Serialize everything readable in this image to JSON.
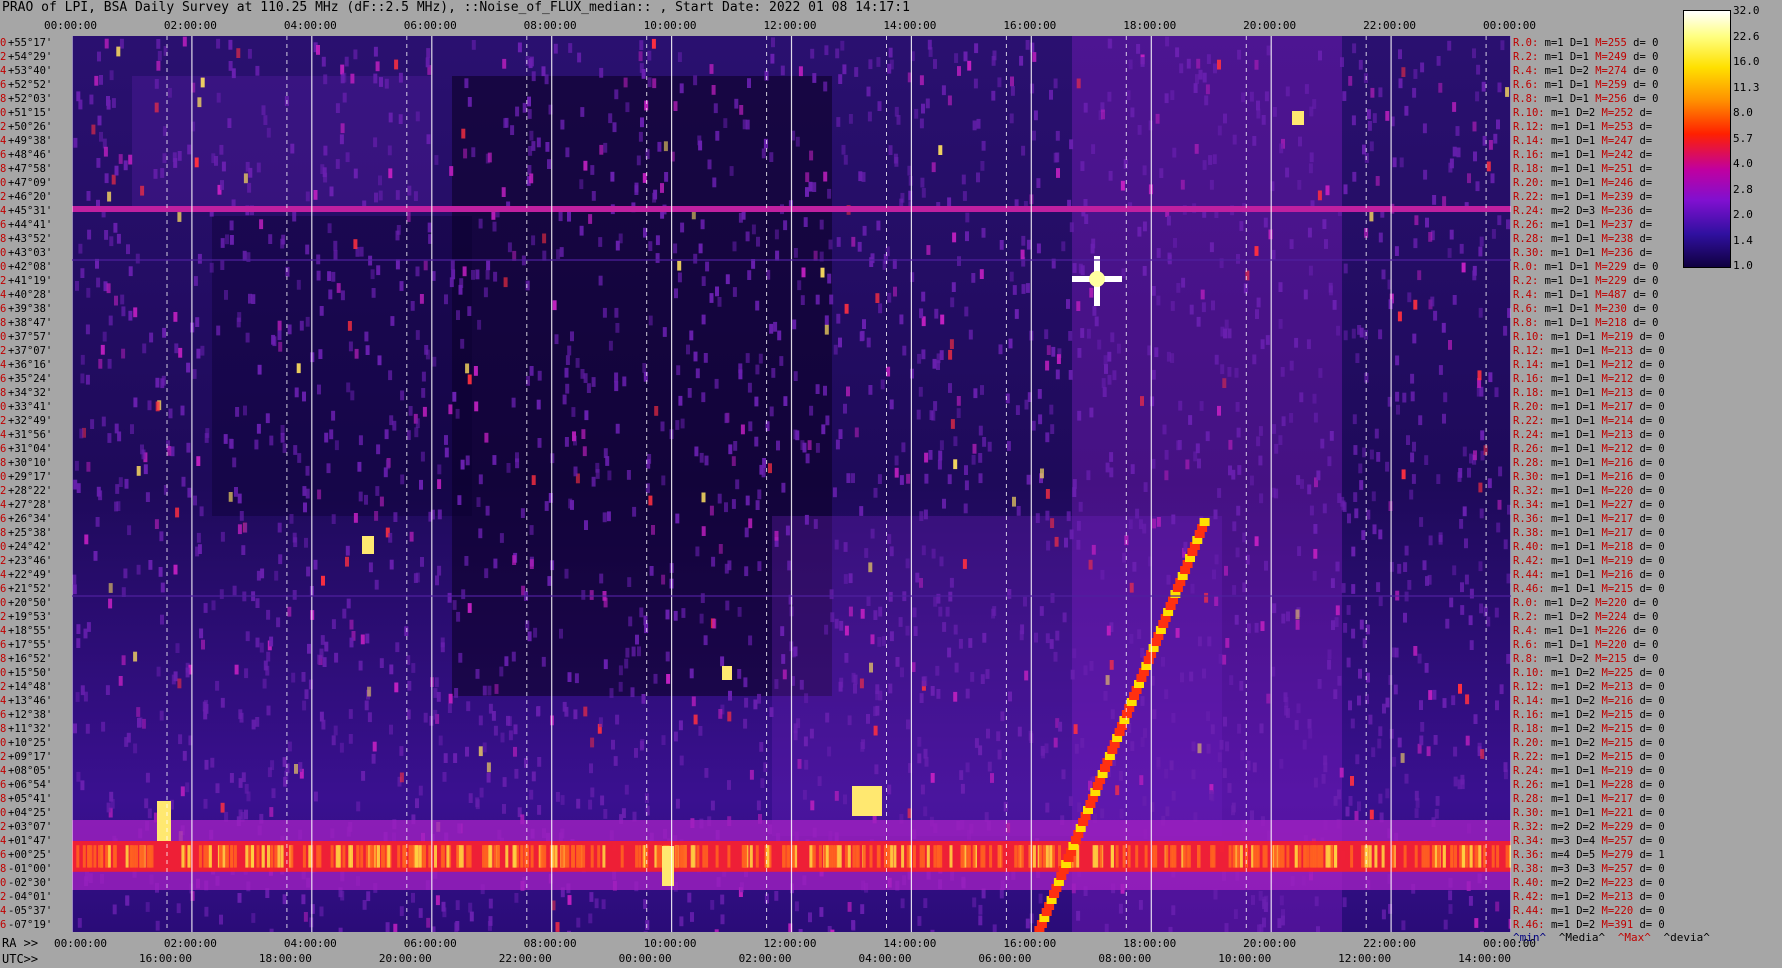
{
  "title": "PRAO of LPI, BSA Daily Survey at 110.25 MHz (dF::2.5 MHz), ::Noise_of_FLUX_median:: , Start Date: 2022 01 08 14:17:1",
  "chart_data": {
    "type": "heatmap",
    "title": "PRAO of LPI, BSA Daily Survey at 110.25 MHz (dF::2.5 MHz), ::Noise_of_FLUX_median:: , Start Date: 2022 01 08 14:17:1",
    "top_axis_ticks": [
      "00:00:00",
      "02:00:00",
      "04:00:00",
      "06:00:00",
      "08:00:00",
      "10:00:00",
      "12:00:00",
      "14:00:00",
      "16:00:00",
      "18:00:00",
      "20:00:00",
      "22:00:00",
      "00:00:00"
    ],
    "ra_axis_label": "RA >>",
    "ra_axis_ticks": [
      "00:00:00",
      "02:00:00",
      "04:00:00",
      "06:00:00",
      "08:00:00",
      "10:00:00",
      "12:00:00",
      "14:00:00",
      "16:00:00",
      "18:00:00",
      "20:00:00",
      "22:00:00",
      "00:00:00"
    ],
    "utc_axis_label": "UTC>>",
    "utc_axis_ticks": [
      "16:00:00",
      "18:00:00",
      "20:00:00",
      "22:00:00",
      "00:00:00",
      "02:00:00",
      "04:00:00",
      "06:00:00",
      "08:00:00",
      "10:00:00",
      "12:00:00",
      "14:00:00"
    ],
    "colorbar_ticks": [
      "32.0",
      "22.6",
      "16.0",
      "11.3",
      "8.0",
      "5.7",
      "4.0",
      "2.8",
      "2.0",
      "1.4",
      "1.0"
    ],
    "declinations": [
      "+55°17'",
      "+54°29'",
      "+53°40'",
      "+52°52'",
      "+52°03'",
      "+51°15'",
      "+50°26'",
      "+49°38'",
      "+48°46'",
      "+47°58'",
      "+47°09'",
      "+46°20'",
      "+45°31'",
      "+44°41'",
      "+43°52'",
      "+43°03'",
      "+42°08'",
      "+41°19'",
      "+40°28'",
      "+39°38'",
      "+38°47'",
      "+37°57'",
      "+37°07'",
      "+36°16'",
      "+35°24'",
      "+34°32'",
      "+33°41'",
      "+32°49'",
      "+31°56'",
      "+31°04'",
      "+30°10'",
      "+29°17'",
      "+28°22'",
      "+27°28'",
      "+26°34'",
      "+25°38'",
      "+24°42'",
      "+23°46'",
      "+22°49'",
      "+21°52'",
      "+20°50'",
      "+19°53'",
      "+18°55'",
      "+17°55'",
      "+16°52'",
      "+15°50'",
      "+14°48'",
      "+13°46'",
      "+12°38'",
      "+11°32'",
      "+10°25'",
      "+09°17'",
      "+08°05'",
      "+06°54'",
      "+05°41'",
      "+04°25'",
      "+03°07'",
      "+01°47'",
      "+00°25'",
      "-01°00'",
      "-02°30'",
      "-04°01'",
      "-05°37'",
      "-07°19'"
    ],
    "row_index": [
      "0",
      "2",
      "4",
      "6",
      "8",
      "10",
      "12",
      "14",
      "16",
      "18",
      "20",
      "22",
      "24",
      "26",
      "28",
      "30",
      "0",
      "2",
      "4",
      "6",
      "8",
      "10",
      "12",
      "14",
      "16",
      "18",
      "20",
      "22",
      "24",
      "26",
      "28",
      "30",
      "32",
      "34",
      "36",
      "38",
      "40",
      "42",
      "44",
      "46",
      "0",
      "2",
      "4",
      "6",
      "8",
      "10",
      "12",
      "14",
      "16",
      "18",
      "20",
      "22",
      "24",
      "26",
      "28",
      "30",
      "32",
      "34",
      "36",
      "38",
      "40",
      "42",
      "44",
      "46"
    ],
    "stats": [
      {
        "r": "R.0:",
        "m": "m=1",
        "D": "D=1",
        "M": "M=255",
        "d": "d= 0"
      },
      {
        "r": "R.2:",
        "m": "m=1",
        "D": "D=1",
        "M": "M=249",
        "d": "d= 0"
      },
      {
        "r": "R.4:",
        "m": "m=1",
        "D": "D=2",
        "M": "M=274",
        "d": "d= 0"
      },
      {
        "r": "R.6:",
        "m": "m=1",
        "D": "D=1",
        "M": "M=259",
        "d": "d= 0"
      },
      {
        "r": "R.8:",
        "m": "m=1",
        "D": "D=1",
        "M": "M=256",
        "d": "d= 0"
      },
      {
        "r": "R.10:",
        "m": "m=1",
        "D": "D=2",
        "M": "M=252",
        "d": "d="
      },
      {
        "r": "R.12:",
        "m": "m=1",
        "D": "D=1",
        "M": "M=253",
        "d": "d="
      },
      {
        "r": "R.14:",
        "m": "m=1",
        "D": "D=1",
        "M": "M=247",
        "d": "d="
      },
      {
        "r": "R.16:",
        "m": "m=1",
        "D": "D=1",
        "M": "M=242",
        "d": "d="
      },
      {
        "r": "R.18:",
        "m": "m=1",
        "D": "D=1",
        "M": "M=251",
        "d": "d="
      },
      {
        "r": "R.20:",
        "m": "m=1",
        "D": "D=1",
        "M": "M=246",
        "d": "d="
      },
      {
        "r": "R.22:",
        "m": "m=1",
        "D": "D=1",
        "M": "M=239",
        "d": "d="
      },
      {
        "r": "R.24:",
        "m": "m=2",
        "D": "D=3",
        "M": "M=236",
        "d": "d="
      },
      {
        "r": "R.26:",
        "m": "m=1",
        "D": "D=1",
        "M": "M=237",
        "d": "d="
      },
      {
        "r": "R.28:",
        "m": "m=1",
        "D": "D=1",
        "M": "M=238",
        "d": "d="
      },
      {
        "r": "R.30:",
        "m": "m=1",
        "D": "D=1",
        "M": "M=236",
        "d": "d="
      },
      {
        "r": "R.0:",
        "m": "m=1",
        "D": "D=1",
        "M": "M=229",
        "d": "d= 0"
      },
      {
        "r": "R.2:",
        "m": "m=1",
        "D": "D=1",
        "M": "M=229",
        "d": "d= 0"
      },
      {
        "r": "R.4:",
        "m": "m=1",
        "D": "D=1",
        "M": "M=487",
        "d": "d= 0"
      },
      {
        "r": "R.6:",
        "m": "m=1",
        "D": "D=1",
        "M": "M=230",
        "d": "d= 0"
      },
      {
        "r": "R.8:",
        "m": "m=1",
        "D": "D=1",
        "M": "M=218",
        "d": "d= 0"
      },
      {
        "r": "R.10:",
        "m": "m=1",
        "D": "D=1",
        "M": "M=219",
        "d": "d= 0"
      },
      {
        "r": "R.12:",
        "m": "m=1",
        "D": "D=1",
        "M": "M=213",
        "d": "d= 0"
      },
      {
        "r": "R.14:",
        "m": "m=1",
        "D": "D=1",
        "M": "M=212",
        "d": "d= 0"
      },
      {
        "r": "R.16:",
        "m": "m=1",
        "D": "D=1",
        "M": "M=212",
        "d": "d= 0"
      },
      {
        "r": "R.18:",
        "m": "m=1",
        "D": "D=1",
        "M": "M=213",
        "d": "d= 0"
      },
      {
        "r": "R.20:",
        "m": "m=1",
        "D": "D=1",
        "M": "M=217",
        "d": "d= 0"
      },
      {
        "r": "R.22:",
        "m": "m=1",
        "D": "D=1",
        "M": "M=214",
        "d": "d= 0"
      },
      {
        "r": "R.24:",
        "m": "m=1",
        "D": "D=1",
        "M": "M=213",
        "d": "d= 0"
      },
      {
        "r": "R.26:",
        "m": "m=1",
        "D": "D=1",
        "M": "M=212",
        "d": "d= 0"
      },
      {
        "r": "R.28:",
        "m": "m=1",
        "D": "D=1",
        "M": "M=216",
        "d": "d= 0"
      },
      {
        "r": "R.30:",
        "m": "m=1",
        "D": "D=1",
        "M": "M=216",
        "d": "d= 0"
      },
      {
        "r": "R.32:",
        "m": "m=1",
        "D": "D=1",
        "M": "M=220",
        "d": "d= 0"
      },
      {
        "r": "R.34:",
        "m": "m=1",
        "D": "D=1",
        "M": "M=227",
        "d": "d= 0"
      },
      {
        "r": "R.36:",
        "m": "m=1",
        "D": "D=1",
        "M": "M=217",
        "d": "d= 0"
      },
      {
        "r": "R.38:",
        "m": "m=1",
        "D": "D=1",
        "M": "M=217",
        "d": "d= 0"
      },
      {
        "r": "R.40:",
        "m": "m=1",
        "D": "D=1",
        "M": "M=218",
        "d": "d= 0"
      },
      {
        "r": "R.42:",
        "m": "m=1",
        "D": "D=1",
        "M": "M=219",
        "d": "d= 0"
      },
      {
        "r": "R.44:",
        "m": "m=1",
        "D": "D=1",
        "M": "M=216",
        "d": "d= 0"
      },
      {
        "r": "R.46:",
        "m": "m=1",
        "D": "D=1",
        "M": "M=215",
        "d": "d= 0"
      },
      {
        "r": "R.0:",
        "m": "m=1",
        "D": "D=2",
        "M": "M=220",
        "d": "d= 0"
      },
      {
        "r": "R.2:",
        "m": "m=1",
        "D": "D=2",
        "M": "M=224",
        "d": "d= 0"
      },
      {
        "r": "R.4:",
        "m": "m=1",
        "D": "D=1",
        "M": "M=226",
        "d": "d= 0"
      },
      {
        "r": "R.6:",
        "m": "m=1",
        "D": "D=1",
        "M": "M=220",
        "d": "d= 0"
      },
      {
        "r": "R.8:",
        "m": "m=1",
        "D": "D=2",
        "M": "M=215",
        "d": "d= 0"
      },
      {
        "r": "R.10:",
        "m": "m=1",
        "D": "D=2",
        "M": "M=225",
        "d": "d= 0"
      },
      {
        "r": "R.12:",
        "m": "m=1",
        "D": "D=2",
        "M": "M=213",
        "d": "d= 0"
      },
      {
        "r": "R.14:",
        "m": "m=1",
        "D": "D=2",
        "M": "M=216",
        "d": "d= 0"
      },
      {
        "r": "R.16:",
        "m": "m=1",
        "D": "D=2",
        "M": "M=215",
        "d": "d= 0"
      },
      {
        "r": "R.18:",
        "m": "m=1",
        "D": "D=2",
        "M": "M=215",
        "d": "d= 0"
      },
      {
        "r": "R.20:",
        "m": "m=1",
        "D": "D=2",
        "M": "M=215",
        "d": "d= 0"
      },
      {
        "r": "R.22:",
        "m": "m=1",
        "D": "D=2",
        "M": "M=215",
        "d": "d= 0"
      },
      {
        "r": "R.24:",
        "m": "m=1",
        "D": "D=1",
        "M": "M=219",
        "d": "d= 0"
      },
      {
        "r": "R.26:",
        "m": "m=1",
        "D": "D=1",
        "M": "M=228",
        "d": "d= 0"
      },
      {
        "r": "R.28:",
        "m": "m=1",
        "D": "D=1",
        "M": "M=217",
        "d": "d= 0"
      },
      {
        "r": "R.30:",
        "m": "m=1",
        "D": "D=1",
        "M": "M=221",
        "d": "d= 0"
      },
      {
        "r": "R.32:",
        "m": "m=2",
        "D": "D=2",
        "M": "M=229",
        "d": "d= 0"
      },
      {
        "r": "R.34:",
        "m": "m=3",
        "D": "D=4",
        "M": "M=257",
        "d": "d= 0"
      },
      {
        "r": "R.36:",
        "m": "m=4",
        "D": "D=5",
        "M": "M=279",
        "d": "d= 1"
      },
      {
        "r": "R.38:",
        "m": "m=3",
        "D": "D=3",
        "M": "M=257",
        "d": "d= 0"
      },
      {
        "r": "R.40:",
        "m": "m=2",
        "D": "D=2",
        "M": "M=223",
        "d": "d= 0"
      },
      {
        "r": "R.42:",
        "m": "m=1",
        "D": "D=2",
        "M": "M=213",
        "d": "d= 0"
      },
      {
        "r": "R.44:",
        "m": "m=1",
        "D": "D=2",
        "M": "M=220",
        "d": "d= 0"
      },
      {
        "r": "R.46:",
        "m": "m=1",
        "D": "D=2",
        "M": "M=391",
        "d": "d= 0"
      }
    ],
    "footer": {
      "min": "^min^",
      "media": "^Media^",
      "max": "^Max^",
      "devia": "^devia^"
    },
    "colors": {
      "min": "#000080",
      "media": "#000000",
      "max": "#c00000",
      "devia": "#000000"
    },
    "grid": true
  }
}
